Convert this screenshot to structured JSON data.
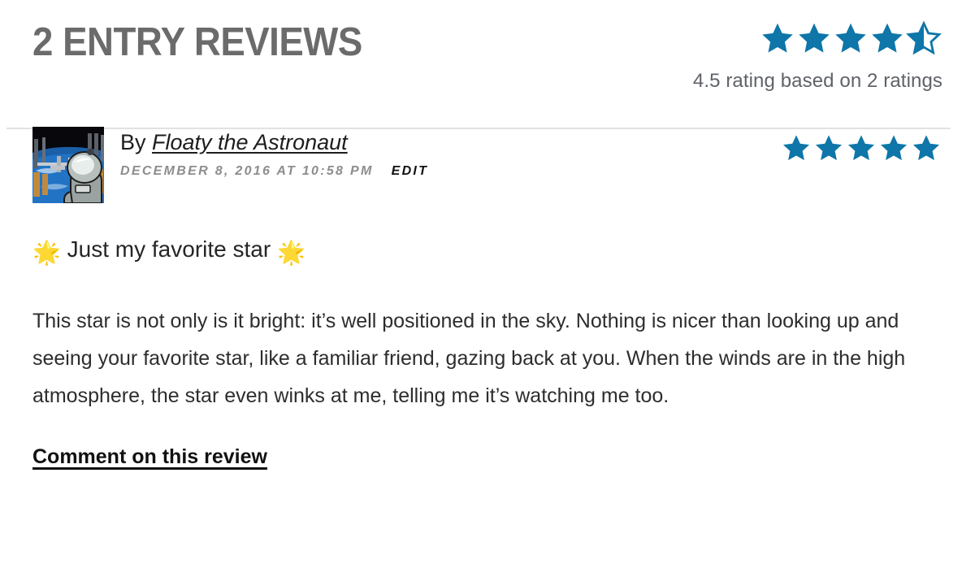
{
  "header": {
    "title": "2 ENTRY REVIEWS",
    "rating_caption": "4.5 rating based on 2 ratings",
    "rating_value": 4.5,
    "rating_count": 2,
    "star_color": "#0e76a8",
    "title_color": "#6b6b6b"
  },
  "review": {
    "avatar_alt": "astronaut-avatar",
    "by_prefix": "By ",
    "author": "Floaty the Astronaut",
    "date": "DECEMBER 8, 2016 AT 10:58 PM",
    "edit_label": "EDIT",
    "stars": 5,
    "title_emoji_left": "🌟",
    "title_text": "Just my favorite star",
    "title_emoji_right": "🌟",
    "body": "This star is not only is it bright: it’s well positioned in the sky. Nothing is nicer than looking up and seeing your favorite star, like a familiar friend, gazing back at you. When the winds are in the high atmosphere, the star even winks at me, telling me it’s watching me too.",
    "comment_link": "Comment on this review"
  }
}
